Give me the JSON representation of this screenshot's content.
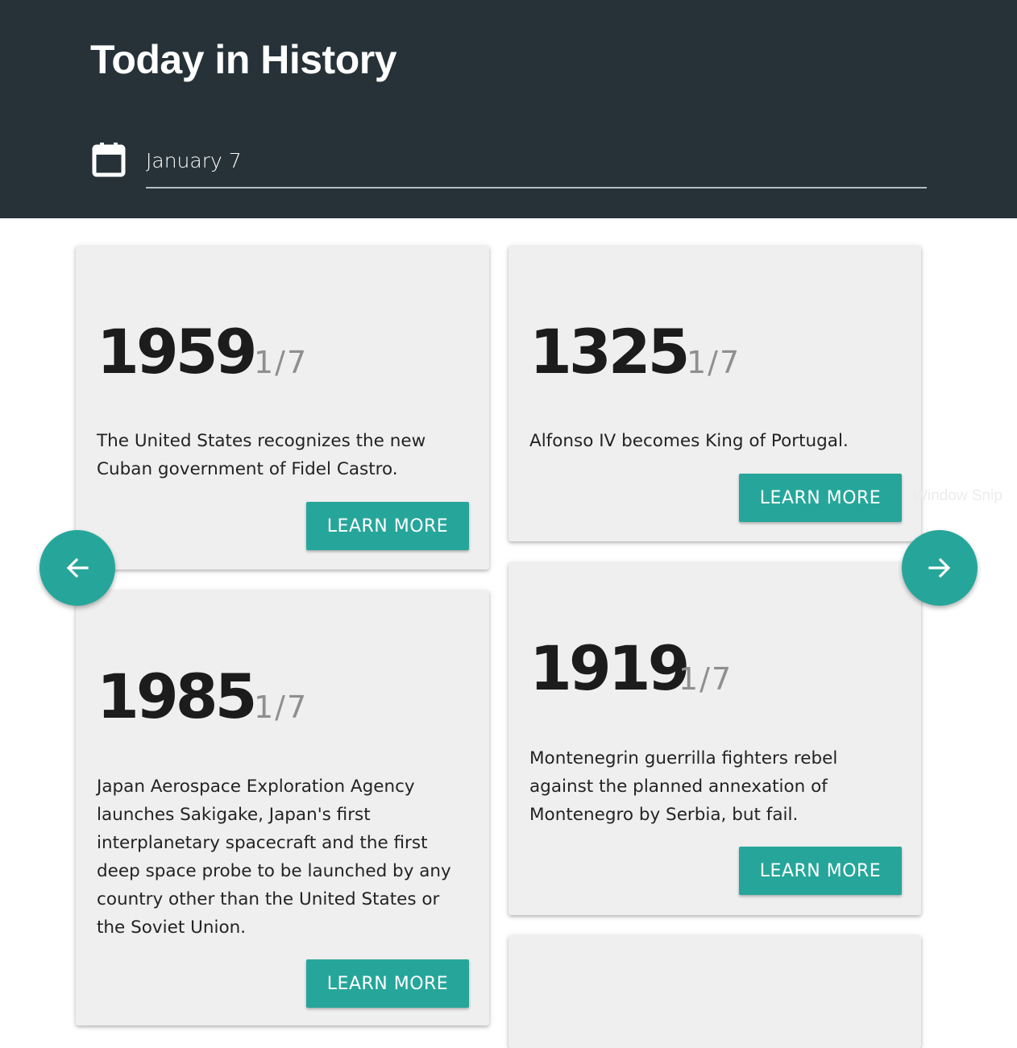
{
  "header": {
    "title": "Today in History",
    "date_value": "January 7"
  },
  "events": [
    {
      "year": "1959",
      "date": "1/7",
      "text": "The United States recognizes the new Cuban government of Fidel Castro.",
      "button": "LEARN MORE"
    },
    {
      "year": "1325",
      "date": "1/7",
      "text": "Alfonso IV becomes King of Portugal.",
      "button": "LEARN MORE"
    },
    {
      "year": "1985",
      "date": "1/7",
      "text": "Japan Aerospace Exploration Agency launches Sakigake, Japan's first interplanetary spacecraft and the first deep space probe to be launched by any country other than the United States or the Soviet Union.",
      "button": "LEARN MORE"
    },
    {
      "year": "1919",
      "date": "1/7",
      "text": "Montenegrin guerrilla fighters rebel against the planned annexation of Montenegro by Serbia, but fail.",
      "button": "LEARN MORE"
    }
  ],
  "nav": {
    "prev_icon": "arrow-left-icon",
    "next_icon": "arrow-right-icon"
  },
  "overlay": {
    "snip_label": "Window Snip"
  },
  "colors": {
    "header_bg": "#263238",
    "accent": "#26a69a",
    "card_bg": "#efefef"
  }
}
